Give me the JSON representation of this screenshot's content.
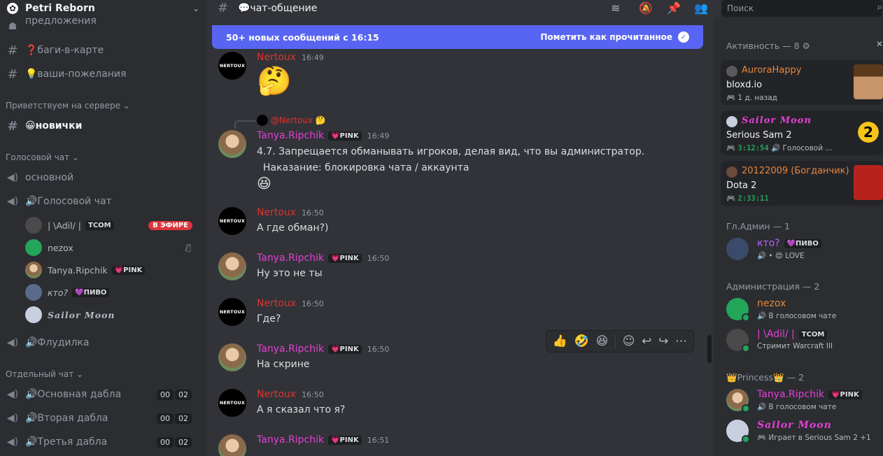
{
  "server": {
    "name": "Petri Reborn"
  },
  "sidebar": {
    "channels_top": [
      {
        "label": "предложения"
      },
      {
        "label": "❓баги-в-карте"
      },
      {
        "label": "💡ваши-пожелания"
      }
    ],
    "cat_welcome": "Приветствуем на сервере",
    "welcome_channel": "😀новички",
    "cat_voice": "Голосовой чат",
    "voice_main": "основной",
    "voice_chat": "🔊Голосовой чат",
    "voice_users": [
      {
        "name": "| \\Adil/ |",
        "tag": "TCOM",
        "badge": "В ЭФИРЕ"
      },
      {
        "name": "nezox"
      },
      {
        "name": "Tanya.Ripchik",
        "tag": "💗PINK"
      },
      {
        "name": "кто?",
        "tag": "💜ПИВО"
      },
      {
        "name": "Sailor Moon"
      }
    ],
    "voice_flood": "🔊Флудилка",
    "cat_separate": "Отдельный чат",
    "duo_rooms": [
      {
        "label": "🔊Основная дабла",
        "c1": "00",
        "c2": "02"
      },
      {
        "label": "🔊Вторая дабла",
        "c1": "00",
        "c2": "02"
      },
      {
        "label": "🔊Третья дабла",
        "c1": "00",
        "c2": "02"
      }
    ]
  },
  "header": {
    "channel": "💬чат-общение",
    "search_placeholder": "Поиск"
  },
  "newbar": {
    "text": "50+ новых сообщений с 16:15",
    "mark": "Пометить как прочитанное"
  },
  "messages": [
    {
      "user": "Nertoux",
      "time": "16:49",
      "emoji": "🤔"
    },
    {
      "reply_user": "@Nertoux 🤔",
      "user": "Tanya.Ripchik",
      "tag": "💗PINK",
      "time": "16:49",
      "line1": "4.7. Запрещается обманывать игроков, делая вид, что вы администратор.",
      "line2": "  Наказание: блокировка чата / аккаунта",
      "line3": "😆"
    },
    {
      "user": "Nertoux",
      "time": "16:50",
      "text": "А где обман?)"
    },
    {
      "user": "Tanya.Ripchik",
      "tag": "💗PINK",
      "time": "16:50",
      "text": "Ну это не ты"
    },
    {
      "user": "Nertoux",
      "time": "16:50",
      "text": "Где?"
    },
    {
      "user": "Tanya.Ripchik",
      "tag": "💗PINK",
      "time": "16:50",
      "text": "На скрине"
    },
    {
      "user": "Nertoux",
      "time": "16:50",
      "text": "А я сказал что я?"
    },
    {
      "user": "Tanya.Ripchik",
      "tag": "💗PINK",
      "time": "16:51"
    }
  ],
  "avatar_text": "NERTOUX",
  "toolbar": {
    "r1": "👍",
    "r2": "🤣",
    "r3": "😆",
    "react": "☺",
    "reply": "↩",
    "fwd": "↪",
    "more": "⋯"
  },
  "members": {
    "activity_header": "Активность — 8 ⚙",
    "activities": [
      {
        "name": "AuroraHappy",
        "game": "bloxd.io",
        "sub": "🎮 1 д. назад"
      },
      {
        "name": "Sailor Moon",
        "game": "Serious Sam 2",
        "timer": "3:12:54",
        "sub": "🔊 Голосовой ..."
      },
      {
        "name": "20122009 (Богданчик)",
        "game": "Dota 2",
        "timer": "2:33:11"
      }
    ],
    "admin_header": "Гл.Админ — 1",
    "admin": {
      "name": "кто?",
      "tag": "💜ПИВО",
      "status": "🔊 • 😍 LOVE"
    },
    "admins_header": "Администрация — 2",
    "admins": [
      {
        "name": "nezox",
        "status": "🔊 В голосовом чате"
      },
      {
        "name": "| \\Adil/ |",
        "tag": "TCOM",
        "status": "Стримит Warcraft III"
      }
    ],
    "princess_header": "👑Princess👑 — 2",
    "princess": [
      {
        "name": "Tanya.Ripchik",
        "tag": "💗PINK",
        "status": "🔊 В голосовом чате"
      },
      {
        "name": "Sailor Moon",
        "status": "🎮 Играет в Serious Sam 2 +1"
      }
    ]
  }
}
